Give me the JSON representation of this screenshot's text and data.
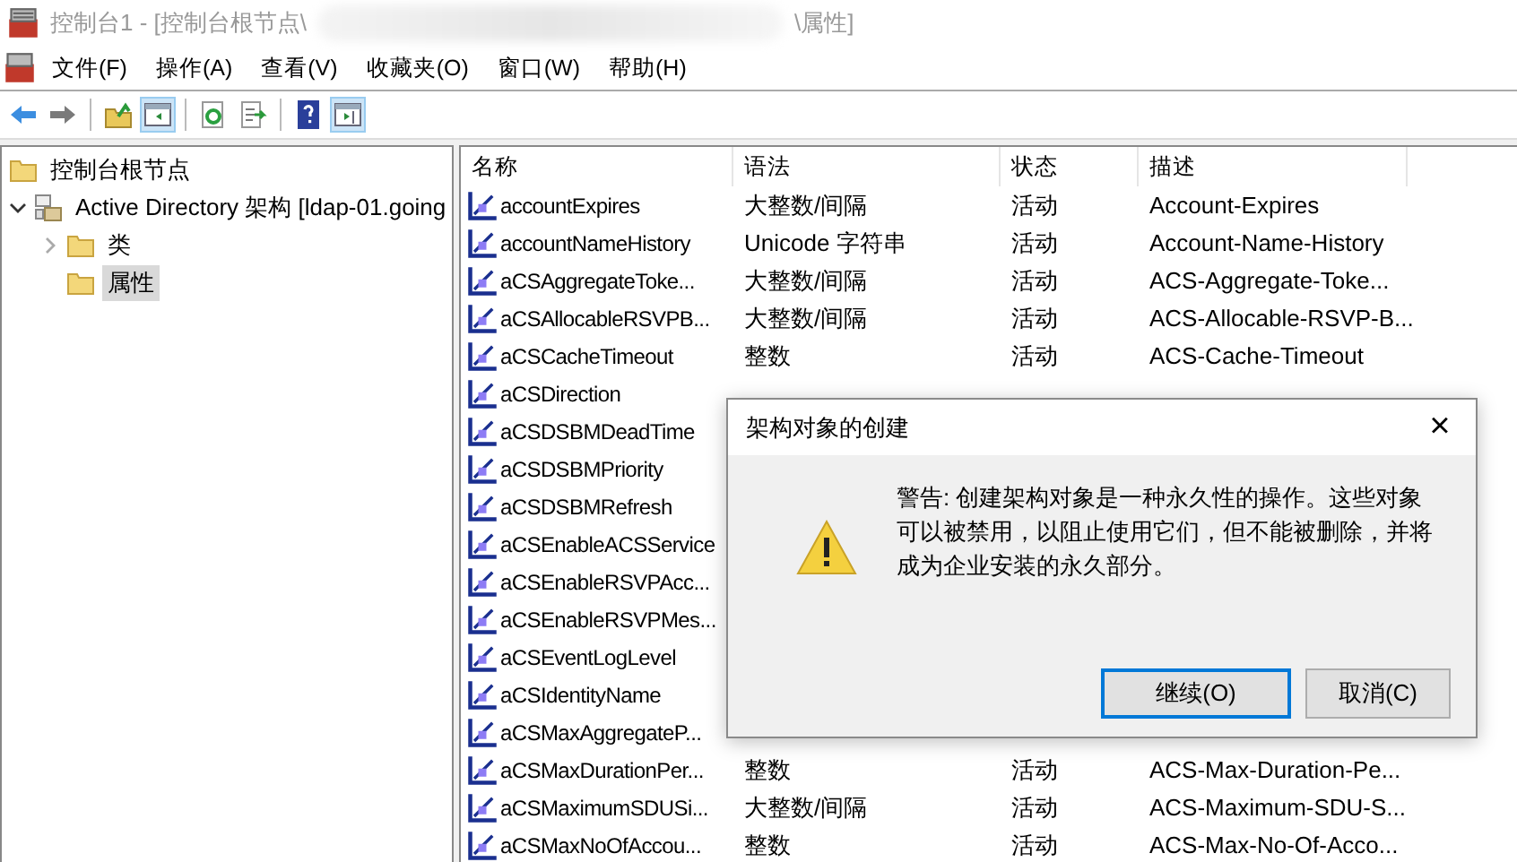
{
  "window": {
    "title_start": "控制台1 - [控制台根节点\\",
    "title_end": "\\属性]"
  },
  "menu": [
    "文件(F)",
    "操作(A)",
    "查看(V)",
    "收藏夹(O)",
    "窗口(W)",
    "帮助(H)"
  ],
  "toolbar": [
    {
      "kind": "back",
      "pressed": false
    },
    {
      "kind": "forward",
      "pressed": false
    },
    {
      "kind": "sep"
    },
    {
      "kind": "up",
      "pressed": false
    },
    {
      "kind": "tree",
      "pressed": true
    },
    {
      "kind": "sep"
    },
    {
      "kind": "refresh",
      "pressed": false
    },
    {
      "kind": "export",
      "pressed": false
    },
    {
      "kind": "sep"
    },
    {
      "kind": "help",
      "pressed": false
    },
    {
      "kind": "actions",
      "pressed": true
    }
  ],
  "tree": [
    {
      "label": "控制台根节点",
      "kind": "folder",
      "selected": false
    },
    {
      "label": "Active Directory 架构 [ldap-01.going",
      "kind": "schema",
      "selected": false,
      "expanded": true,
      "children": [
        {
          "label": "类",
          "kind": "folder",
          "selected": false,
          "expanded": false
        },
        {
          "label": "属性",
          "kind": "folder",
          "selected": true
        }
      ]
    }
  ],
  "table": {
    "columns": [
      "名称",
      "语法",
      "状态",
      "描述"
    ],
    "rows": [
      {
        "name": "accountExpires",
        "syntax": "大整数/间隔",
        "status": "活动",
        "description": "Account-Expires"
      },
      {
        "name": "accountNameHistory",
        "syntax": "Unicode 字符串",
        "status": "活动",
        "description": "Account-Name-History"
      },
      {
        "name": "aCSAggregateToke...",
        "syntax": "大整数/间隔",
        "status": "活动",
        "description": "ACS-Aggregate-Toke..."
      },
      {
        "name": "aCSAllocableRSVPB...",
        "syntax": "大整数/间隔",
        "status": "活动",
        "description": "ACS-Allocable-RSVP-B..."
      },
      {
        "name": "aCSCacheTimeout",
        "syntax": "整数",
        "status": "活动",
        "description": "ACS-Cache-Timeout"
      },
      {
        "name": "aCSDirection"
      },
      {
        "name": "aCSDSBMDeadTime"
      },
      {
        "name": "aCSDSBMPriority"
      },
      {
        "name": "aCSDSBMRefresh"
      },
      {
        "name": "aCSEnableACSService"
      },
      {
        "name": "aCSEnableRSVPAcc..."
      },
      {
        "name": "aCSEnableRSVPMes..."
      },
      {
        "name": "aCSEventLogLevel"
      },
      {
        "name": "aCSIdentityName"
      },
      {
        "name": "aCSMaxAggregateP..."
      },
      {
        "name": "aCSMaxDurationPer...",
        "syntax": "整数",
        "status": "活动",
        "description": "ACS-Max-Duration-Pe..."
      },
      {
        "name": "aCSMaximumSDUSi...",
        "syntax": "大整数/间隔",
        "status": "活动",
        "description": "ACS-Maximum-SDU-S..."
      },
      {
        "name": "aCSMaxNoOfAccou...",
        "syntax": "整数",
        "status": "活动",
        "description": "ACS-Max-No-Of-Acco..."
      }
    ]
  },
  "dialog": {
    "title": "架构对象的创建",
    "close": "×",
    "message": "警告: 创建架构对象是一种永久性的操作。这些对象可以被禁用，以阻止使用它们，但不能被删除，并将成为企业安装的永久部分。",
    "buttons": [
      {
        "label": "继续(O)",
        "default": true
      },
      {
        "label": "取消(C)",
        "default": false
      }
    ]
  }
}
